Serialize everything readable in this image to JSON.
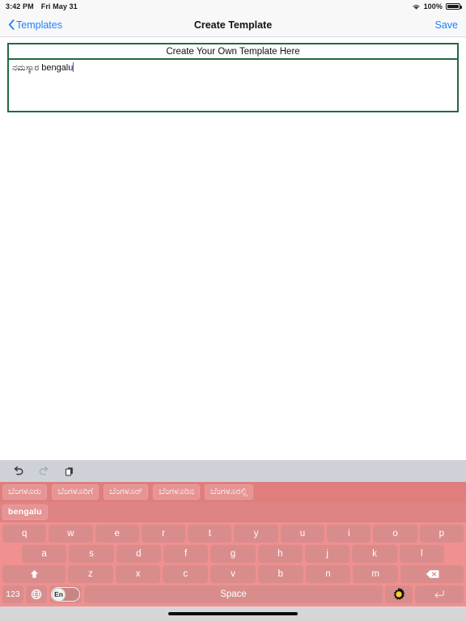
{
  "status_bar": {
    "time": "3:42 PM",
    "date": "Fri May 31",
    "battery_pct": "100%",
    "wifi_icon": "wifi-icon",
    "battery_icon": "battery-icon"
  },
  "nav_bar": {
    "back_label": "Templates",
    "back_icon": "chevron-left-icon",
    "title": "Create Template",
    "save_label": "Save",
    "accent_color": "#1a82ff"
  },
  "template": {
    "header_label": "Create Your Own Template Here",
    "body_text": "ನಮಸ್ಕಾರ bengalu",
    "border_color": "#24693f",
    "caret_color": "#2b6ef0"
  },
  "keyboard": {
    "toolbar": {
      "undo_icon": "undo-icon",
      "redo_icon": "redo-icon",
      "copy_icon": "copy-icon"
    },
    "suggestions_primary": [
      "ಬೆಂಗಳೂರು",
      "ಬೆಂಗಳೂರಿಗೆ",
      "ಬೆಂಗಳೂರ್",
      "ಬೆಂಗಳೂರಿನ",
      "ಬೆಂಗಳೂರಲ್ಲಿ"
    ],
    "suggestions_secondary": [
      "bengalu"
    ],
    "row1": [
      "q",
      "w",
      "e",
      "r",
      "t",
      "y",
      "u",
      "i",
      "o",
      "p"
    ],
    "row2": [
      "a",
      "s",
      "d",
      "f",
      "g",
      "h",
      "j",
      "k",
      "l"
    ],
    "row3": [
      "z",
      "x",
      "c",
      "v",
      "b",
      "n",
      "m"
    ],
    "shift_icon": "shift-icon",
    "backspace_icon": "backspace-icon",
    "numbers_label": "123",
    "globe_icon": "globe-icon",
    "language_toggle_label": "En",
    "space_label": "Space",
    "gear_icon": "gear-icon",
    "return_icon": "return-icon",
    "key_color": "#d98c8c",
    "board_color": "#f0908f",
    "suggestion_bar_color": "#e07e7e",
    "toolbar_color": "#ced2d8"
  },
  "home_indicator": {
    "icon": "home-indicator"
  }
}
